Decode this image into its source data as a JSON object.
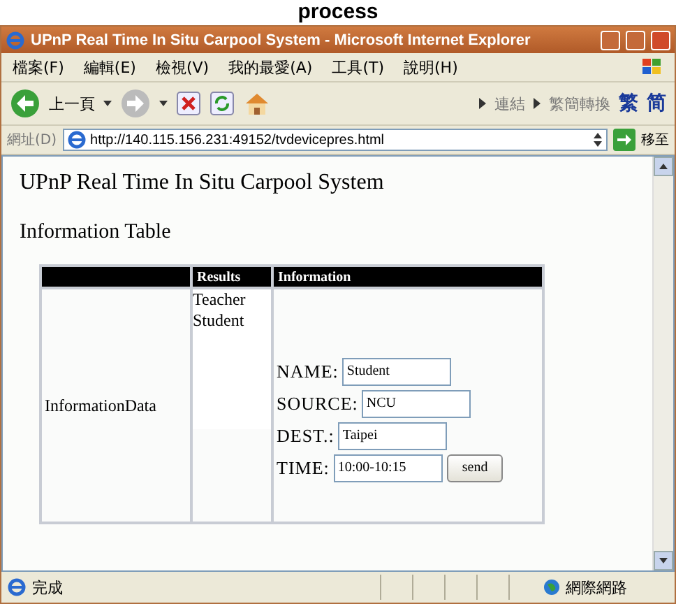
{
  "caption": "process",
  "window": {
    "title": "UPnP Real Time In Situ Carpool System - Microsoft Internet Explorer"
  },
  "menu": [
    "檔案(F)",
    "編輯(E)",
    "檢視(V)",
    "我的最愛(A)",
    "工具(T)",
    "說明(H)"
  ],
  "toolbar": {
    "back_label": "上一頁",
    "links_label": "連結",
    "convert_label": "繁簡轉換",
    "traditional": "繁",
    "simplified": "简"
  },
  "address": {
    "label": "網址(D)",
    "url": "http://140.115.156.231:49152/tvdevicepres.html",
    "go_label": "移至"
  },
  "page": {
    "title": "UPnP Real Time In Situ Carpool System",
    "subtitle": "Information Table",
    "table": {
      "columns": [
        "Results",
        "Information"
      ],
      "row_label": "InformationData",
      "results": [
        "Teacher",
        "Student"
      ],
      "fields": [
        {
          "label": "NAME:",
          "value": "Student"
        },
        {
          "label": "SOURCE:",
          "value": "NCU"
        },
        {
          "label": "DEST.:",
          "value": "Taipei"
        },
        {
          "label": "TIME:",
          "value": "10:00-10:15"
        }
      ],
      "button": "send"
    }
  },
  "status_bar": {
    "text": "完成",
    "zone": "網際網路"
  }
}
